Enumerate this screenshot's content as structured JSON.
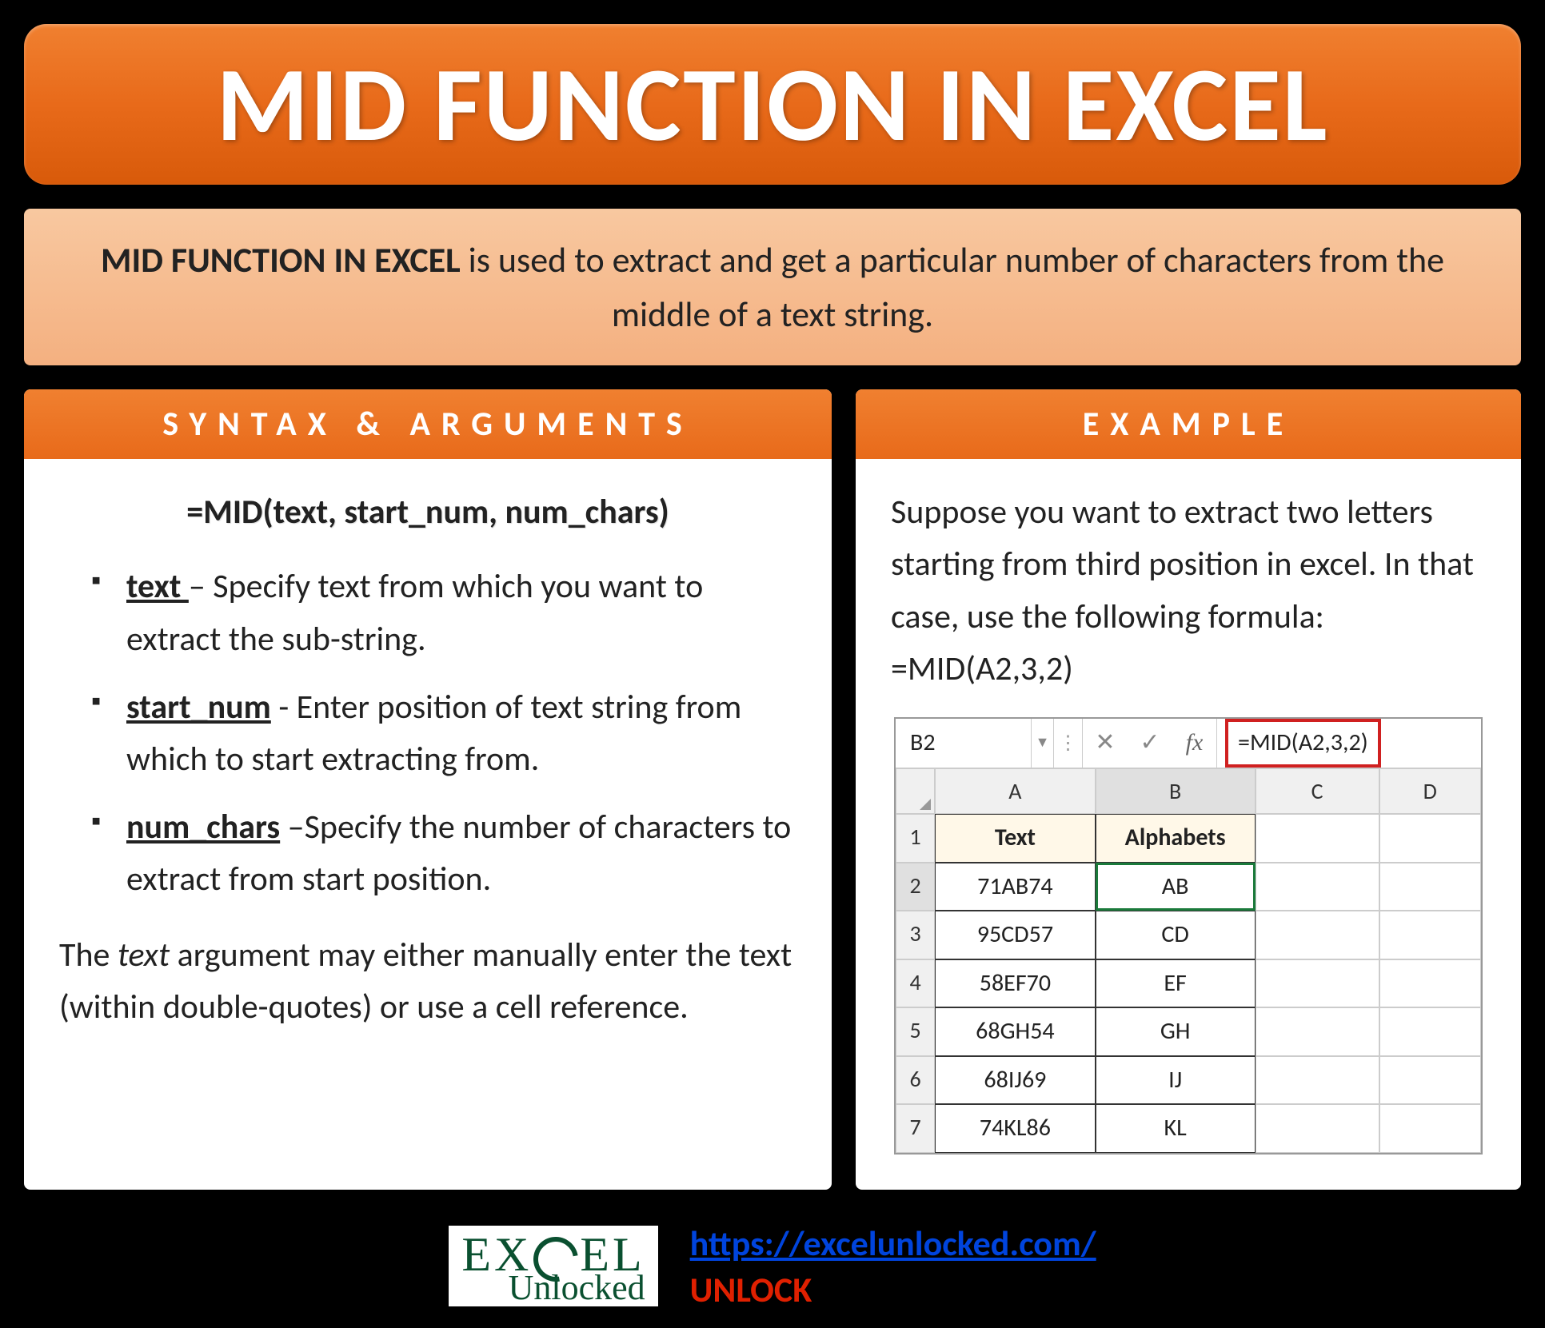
{
  "title": "MID FUNCTION IN EXCEL",
  "description": {
    "bold": "MID FUNCTION IN EXCEL",
    "rest": " is used to extract and get a particular number of characters from the middle of a text string."
  },
  "left_panel": {
    "header": "SYNTAX & ARGUMENTS",
    "syntax": "=MID(text, start_num, num_chars)",
    "args": [
      {
        "name": "text ",
        "desc": "– Specify text from which you want to extract the sub-string."
      },
      {
        "name": "start_num",
        "desc": " - Enter position of text string from which to start extracting from."
      },
      {
        "name": "num_chars",
        "desc": " –Specify the number of characters to extract from start position."
      }
    ],
    "note_pre": "The ",
    "note_ital": "text",
    "note_post": " argument may either manually enter the text (within double-quotes) or use a cell reference."
  },
  "right_panel": {
    "header": "EXAMPLE",
    "text": "Suppose you want to extract two letters starting from third position in excel. In that case, use the following formula: =MID(A2,3,2)",
    "fx": {
      "cell_ref": "B2",
      "formula": "=MID(A2,3,2)",
      "fx_label": "fx"
    },
    "sheet": {
      "cols": [
        "A",
        "B",
        "C",
        "D"
      ],
      "header_row": {
        "A": "Text",
        "B": "Alphabets"
      },
      "rows": [
        {
          "n": "1"
        },
        {
          "n": "2",
          "A": "71AB74",
          "B": "AB"
        },
        {
          "n": "3",
          "A": "95CD57",
          "B": "CD"
        },
        {
          "n": "4",
          "A": "58EF70",
          "B": "EF"
        },
        {
          "n": "5",
          "A": "68GH54",
          "B": "GH"
        },
        {
          "n": "6",
          "A": "68IJ69",
          "B": "IJ"
        },
        {
          "n": "7",
          "A": "74KL86",
          "B": "KL"
        }
      ]
    }
  },
  "footer": {
    "logo_top_pre": "EX",
    "logo_top_post": "EL",
    "logo_bottom": "Unlocked",
    "url": "https://excelunlocked.com/",
    "unlock": "UNLOCK"
  }
}
